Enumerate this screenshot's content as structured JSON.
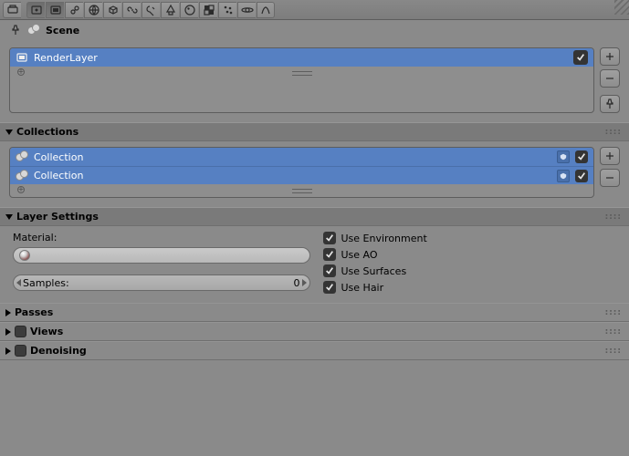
{
  "scene": {
    "label": "Scene"
  },
  "renderlayers": {
    "items": [
      {
        "name": "RenderLayer",
        "enabled": true
      }
    ]
  },
  "collections": {
    "title": "Collections",
    "items": [
      {
        "name": "Collection",
        "enabled": true
      },
      {
        "name": "Collection",
        "enabled": true
      }
    ]
  },
  "layer_settings": {
    "title": "Layer Settings",
    "material_label": "Material:",
    "samples_label": "Samples:",
    "samples_value": "0",
    "use_environment": "Use Environment",
    "use_ao": "Use AO",
    "use_surfaces": "Use Surfaces",
    "use_hair": "Use Hair"
  },
  "panels": {
    "passes": "Passes",
    "views": "Views",
    "denoising": "Denoising"
  },
  "icons": {
    "toolbar": [
      "render-icon",
      "scene-icon",
      "renderlayers-icon",
      "particles-icon",
      "world-icon",
      "object-icon",
      "modifiers-icon",
      "constraints-icon",
      "data-icon",
      "physics-icon",
      "material-icon",
      "texture-icon",
      "lattice-icon",
      "bone-icon"
    ]
  }
}
